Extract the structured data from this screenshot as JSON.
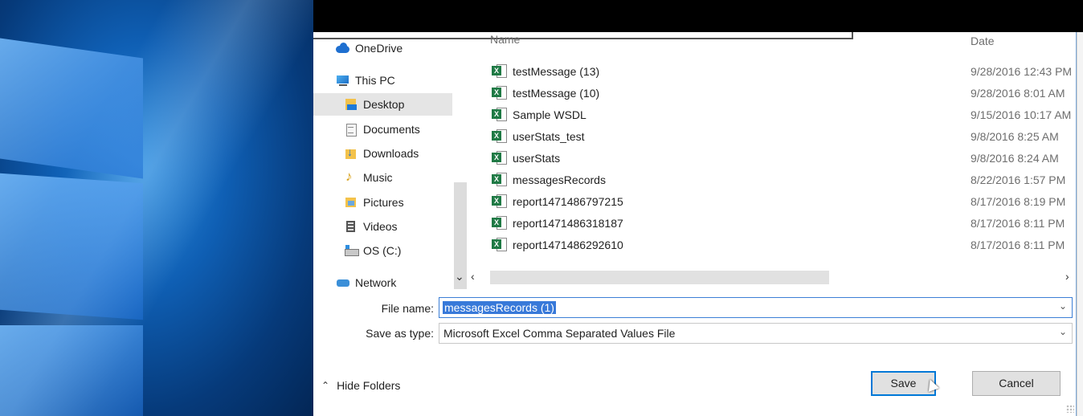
{
  "navigation": {
    "items": [
      {
        "label": "OneDrive",
        "icon": "onedrive-icon"
      },
      {
        "label": "This PC",
        "icon": "this-pc-icon"
      },
      {
        "label": "Desktop",
        "icon": "desktop-folder-icon",
        "selected": true
      },
      {
        "label": "Documents",
        "icon": "documents-folder-icon"
      },
      {
        "label": "Downloads",
        "icon": "downloads-folder-icon"
      },
      {
        "label": "Music",
        "icon": "music-folder-icon"
      },
      {
        "label": "Pictures",
        "icon": "pictures-folder-icon"
      },
      {
        "label": "Videos",
        "icon": "videos-folder-icon"
      },
      {
        "label": "OS (C:)",
        "icon": "drive-icon"
      },
      {
        "label": "Network",
        "icon": "network-icon"
      }
    ]
  },
  "file_list": {
    "columns": {
      "name": "Name",
      "date": "Date"
    },
    "files": [
      {
        "name": "testMessage (13)",
        "date": "9/28/2016 12:43 PM"
      },
      {
        "name": "testMessage (10)",
        "date": "9/28/2016 8:01 AM"
      },
      {
        "name": "Sample WSDL",
        "date": "9/15/2016 10:17 AM"
      },
      {
        "name": "userStats_test",
        "date": "9/8/2016 8:25 AM"
      },
      {
        "name": "userStats",
        "date": "9/8/2016 8:24 AM"
      },
      {
        "name": "messagesRecords",
        "date": "8/22/2016 1:57 PM"
      },
      {
        "name": "report1471486797215",
        "date": "8/17/2016 8:19 PM"
      },
      {
        "name": "report1471486318187",
        "date": "8/17/2016 8:11 PM"
      },
      {
        "name": "report1471486292610",
        "date": "8/17/2016 8:11 PM"
      }
    ],
    "file_icon": "excel-csv-file-icon"
  },
  "form": {
    "file_name_label": "File name:",
    "file_name_value": "messagesRecords (1)",
    "save_as_type_label": "Save as type:",
    "save_as_type_value": "Microsoft Excel Comma Separated Values File"
  },
  "footer": {
    "hide_folders_label": "Hide Folders",
    "save_label": "Save",
    "cancel_label": "Cancel"
  },
  "colors": {
    "accent": "#0078d7",
    "selection": "#3879d9",
    "excel_green": "#1f7a45"
  }
}
